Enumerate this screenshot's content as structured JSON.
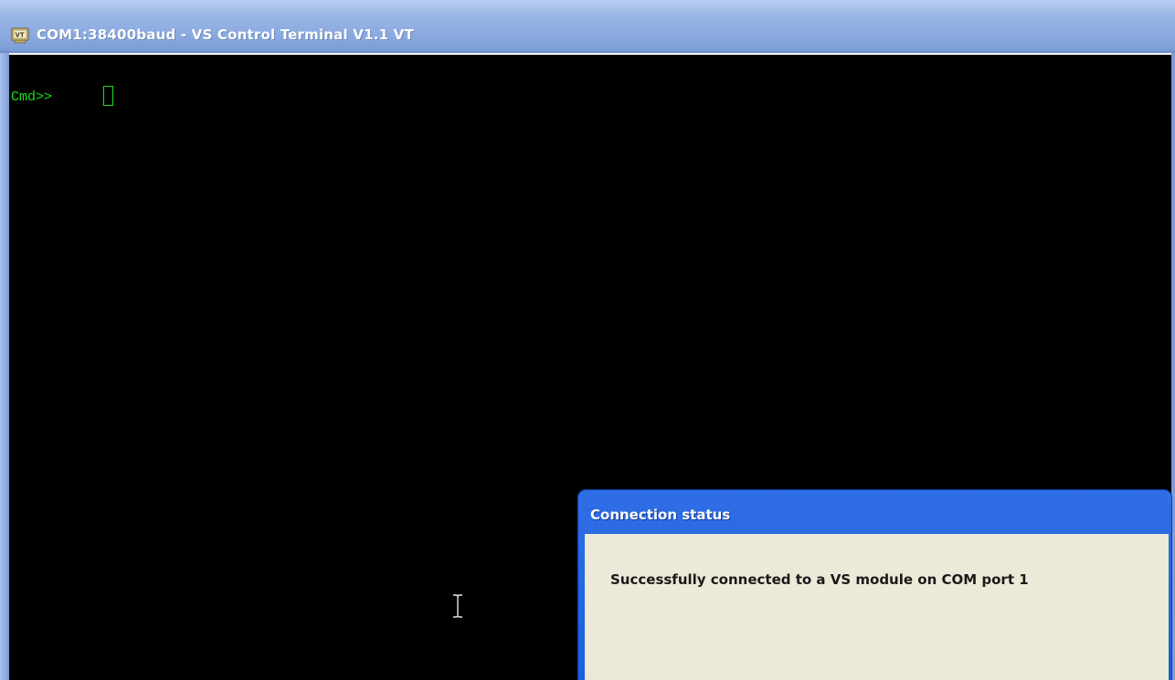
{
  "window": {
    "title": "COM1:38400baud - VS Control Terminal V1.1 VT",
    "icon": "vt-app-icon"
  },
  "terminal": {
    "prompt": "Cmd>> ",
    "text_color": "#18e018",
    "background": "#000000"
  },
  "dialog": {
    "title": "Connection status",
    "message": "Successfully connected to a VS module on COM port 1",
    "title_color": "#2f6ee6",
    "body_color": "#ece9d8"
  }
}
